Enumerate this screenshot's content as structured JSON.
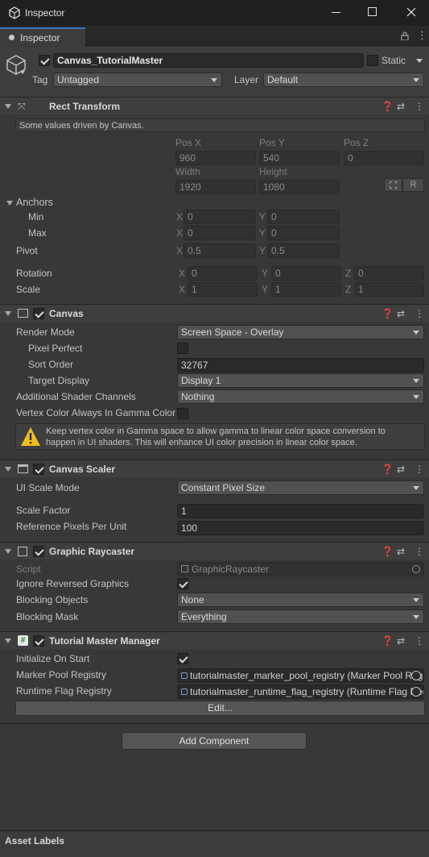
{
  "window": {
    "title": "Inspector"
  },
  "tab": {
    "label": "Inspector"
  },
  "object": {
    "name": "Canvas_TutorialMaster",
    "static_label": "Static",
    "tag_label": "Tag",
    "tag_value": "Untagged",
    "layer_label": "Layer",
    "layer_value": "Default"
  },
  "rect_transform": {
    "title": "Rect Transform",
    "info": "Some values driven by Canvas.",
    "posx_label": "Pos X",
    "posy_label": "Pos Y",
    "posz_label": "Pos Z",
    "posx": "960",
    "posy": "540",
    "posz": "0",
    "width_label": "Width",
    "height_label": "Height",
    "width": "1920",
    "height": "1080",
    "r_button": "R",
    "anchors_label": "Anchors",
    "min_label": "Min",
    "max_label": "Max",
    "min_x": "0",
    "min_y": "0",
    "max_x": "0",
    "max_y": "0",
    "pivot_label": "Pivot",
    "pivot_x": "0.5",
    "pivot_y": "0.5",
    "rotation_label": "Rotation",
    "rot_x": "0",
    "rot_y": "0",
    "rot_z": "0",
    "scale_label": "Scale",
    "scale_x": "1",
    "scale_y": "1",
    "scale_z": "1",
    "x": "X",
    "y": "Y",
    "z": "Z"
  },
  "canvas": {
    "title": "Canvas",
    "render_mode_label": "Render Mode",
    "render_mode": "Screen Space - Overlay",
    "pixel_perfect_label": "Pixel Perfect",
    "sort_order_label": "Sort Order",
    "sort_order": "32767",
    "target_display_label": "Target Display",
    "target_display": "Display 1",
    "shader_channels_label": "Additional Shader Channels",
    "shader_channels": "Nothing",
    "vertex_gamma_label": "Vertex Color Always In Gamma Color Space",
    "warning_line1": "Keep vertex color in Gamma space to allow gamma to linear color space conversion to",
    "warning_line2": "happen in UI shaders. This will enhance UI color precision in linear color space."
  },
  "canvas_scaler": {
    "title": "Canvas Scaler",
    "ui_scale_mode_label": "UI Scale Mode",
    "ui_scale_mode": "Constant Pixel Size",
    "scale_factor_label": "Scale Factor",
    "scale_factor": "1",
    "ref_ppu_label": "Reference Pixels Per Unit",
    "ref_ppu": "100"
  },
  "graphic_raycaster": {
    "title": "Graphic Raycaster",
    "script_label": "Script",
    "script_value": "GraphicRaycaster",
    "ignore_reversed_label": "Ignore Reversed Graphics",
    "blocking_objects_label": "Blocking Objects",
    "blocking_objects": "None",
    "blocking_mask_label": "Blocking Mask",
    "blocking_mask": "Everything"
  },
  "tutorial_master": {
    "title": "Tutorial Master Manager",
    "init_label": "Initialize On Start",
    "marker_pool_label": "Marker Pool Registry",
    "marker_pool_value": "tutorialmaster_marker_pool_registry (Marker Pool Registry)",
    "runtime_flag_label": "Runtime Flag Registry",
    "runtime_flag_value": "tutorialmaster_runtime_flag_registry (Runtime Flag Registry)",
    "edit_button": "Edit..."
  },
  "add_component": "Add Component",
  "asset_labels": "Asset Labels",
  "colors": {
    "background": "#383838",
    "header": "#3e3e3e",
    "titlebar": "#202020",
    "field": "#2a2a2a",
    "dropdown": "#515151",
    "warning": "#f0c020"
  }
}
